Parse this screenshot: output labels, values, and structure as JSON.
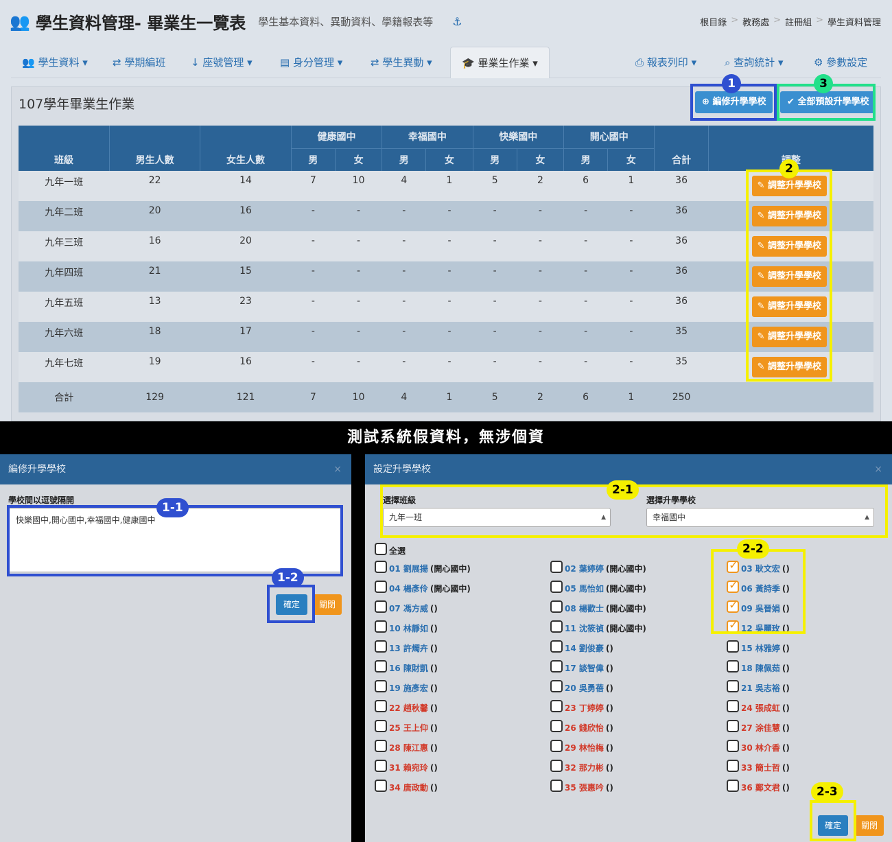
{
  "header": {
    "title": "學生資料管理- 畢業生一覽表",
    "subtitle": "學生基本資料、異動資料、學籍報表等",
    "breadcrumb": [
      "根目錄",
      "教務處",
      "註冊組",
      "學生資料管理"
    ]
  },
  "nav": {
    "items": [
      "學生資料",
      "學期編班",
      "座號管理",
      "身分管理",
      "學生異動",
      "畢業生作業"
    ],
    "right_items": [
      "報表列印",
      "查詢統計",
      "參數設定"
    ]
  },
  "panel": {
    "title": "107學年畢業生作業",
    "edit_button": "編修升學學校",
    "preset_button": "全部預設升學學校"
  },
  "table": {
    "group_headers": [
      "健康國中",
      "幸福國中",
      "快樂國中",
      "開心國中"
    ],
    "col_headers": [
      "班級",
      "男生人數",
      "女生人數",
      "合計",
      "調整"
    ],
    "gender": [
      "男",
      "女"
    ],
    "rows": [
      [
        "九年一班",
        "22",
        "14",
        "7",
        "10",
        "4",
        "1",
        "5",
        "2",
        "6",
        "1",
        "36"
      ],
      [
        "九年二班",
        "20",
        "16",
        "-",
        "-",
        "-",
        "-",
        "-",
        "-",
        "-",
        "-",
        "36"
      ],
      [
        "九年三班",
        "16",
        "20",
        "-",
        "-",
        "-",
        "-",
        "-",
        "-",
        "-",
        "-",
        "36"
      ],
      [
        "九年四班",
        "21",
        "15",
        "-",
        "-",
        "-",
        "-",
        "-",
        "-",
        "-",
        "-",
        "36"
      ],
      [
        "九年五班",
        "13",
        "23",
        "-",
        "-",
        "-",
        "-",
        "-",
        "-",
        "-",
        "-",
        "36"
      ],
      [
        "九年六班",
        "18",
        "17",
        "-",
        "-",
        "-",
        "-",
        "-",
        "-",
        "-",
        "-",
        "35"
      ],
      [
        "九年七班",
        "19",
        "16",
        "-",
        "-",
        "-",
        "-",
        "-",
        "-",
        "-",
        "-",
        "35"
      ],
      [
        "合計",
        "129",
        "121",
        "7",
        "10",
        "4",
        "1",
        "5",
        "2",
        "6",
        "1",
        "250"
      ]
    ],
    "adjust_label": "調整升學學校"
  },
  "banner": "測試系統假資料，無涉個資",
  "modal_edit": {
    "title": "編修升學學校",
    "label": "學校間以逗號隔開",
    "value": "快樂國中,開心國中,幸福國中,健康國中",
    "ok": "確定",
    "close": "關閉"
  },
  "modal_set": {
    "title": "設定升學學校",
    "class_label": "選擇班級",
    "class_value": "九年一班",
    "school_label": "選擇升學學校",
    "school_value": "幸福國中",
    "select_all": "全選",
    "students": [
      [
        "01 劉展揚",
        " (開心國中)",
        "b",
        false
      ],
      [
        "02 葉婷婷",
        " (開心國中)",
        "b",
        false
      ],
      [
        "03 耿文宏",
        " ()",
        "b",
        true
      ],
      [
        "04 楊彥伶",
        " (開心國中)",
        "b",
        false
      ],
      [
        "05 馬怡如",
        " (開心國中)",
        "b",
        false
      ],
      [
        "06 黃詩季",
        " ()",
        "b",
        true
      ],
      [
        "07 馮方威",
        " ()",
        "b",
        false
      ],
      [
        "08 楊歡士",
        " (開心國中)",
        "b",
        false
      ],
      [
        "09 吳晉娟",
        " ()",
        "b",
        true
      ],
      [
        "10 林靜如",
        " ()",
        "b",
        false
      ],
      [
        "11 沈筱禎",
        " (開心國中)",
        "b",
        false
      ],
      [
        "12 吳麗玫",
        " ()",
        "b",
        true
      ],
      [
        "13 許燭卉",
        " ()",
        "b",
        false
      ],
      [
        "14 劉俊豪",
        " ()",
        "b",
        false
      ],
      [
        "15 林雅婷",
        " ()",
        "b",
        false
      ],
      [
        "16 陳財凱",
        " ()",
        "b",
        false
      ],
      [
        "17 談智偉",
        " ()",
        "b",
        false
      ],
      [
        "18 陳佩茹",
        " ()",
        "b",
        false
      ],
      [
        "19 施彥宏",
        " ()",
        "b",
        false
      ],
      [
        "20 吳勇蓓",
        " ()",
        "b",
        false
      ],
      [
        "21 吳志裕",
        " ()",
        "b",
        false
      ],
      [
        "22 趙秋馨",
        " ()",
        "r",
        false
      ],
      [
        "23 丁婷婷",
        " ()",
        "r",
        false
      ],
      [
        "24 張成虹",
        " ()",
        "r",
        false
      ],
      [
        "25 王上仰",
        " ()",
        "r",
        false
      ],
      [
        "26 錢欣怡",
        " ()",
        "r",
        false
      ],
      [
        "27 涂佳慧",
        " ()",
        "r",
        false
      ],
      [
        "28 陳江惠",
        " ()",
        "r",
        false
      ],
      [
        "29 林怡梅",
        " ()",
        "r",
        false
      ],
      [
        "30 林介香",
        " ()",
        "r",
        false
      ],
      [
        "31 賴宛玲",
        " ()",
        "r",
        false
      ],
      [
        "32 那力彬",
        " ()",
        "r",
        false
      ],
      [
        "33 簡士哲",
        " ()",
        "r",
        false
      ],
      [
        "34 唐政動",
        " ()",
        "r",
        false
      ],
      [
        "35 張惠吟",
        " ()",
        "r",
        false
      ],
      [
        "36 鄭文君",
        " ()",
        "r",
        false
      ]
    ],
    "ok": "確定",
    "close": "關閉"
  },
  "callouts": {
    "c1": "1",
    "c2": "2",
    "c3": "3",
    "c11": "1-1",
    "c12": "1-2",
    "c21": "2-1",
    "c22": "2-2",
    "c23": "2-3"
  },
  "colors": {
    "navy": "#2b6396",
    "orange": "#f0951c",
    "blue_hl": "#2f4fd0",
    "yellow_hl": "#f5f000",
    "green_hl": "#22e08a"
  }
}
